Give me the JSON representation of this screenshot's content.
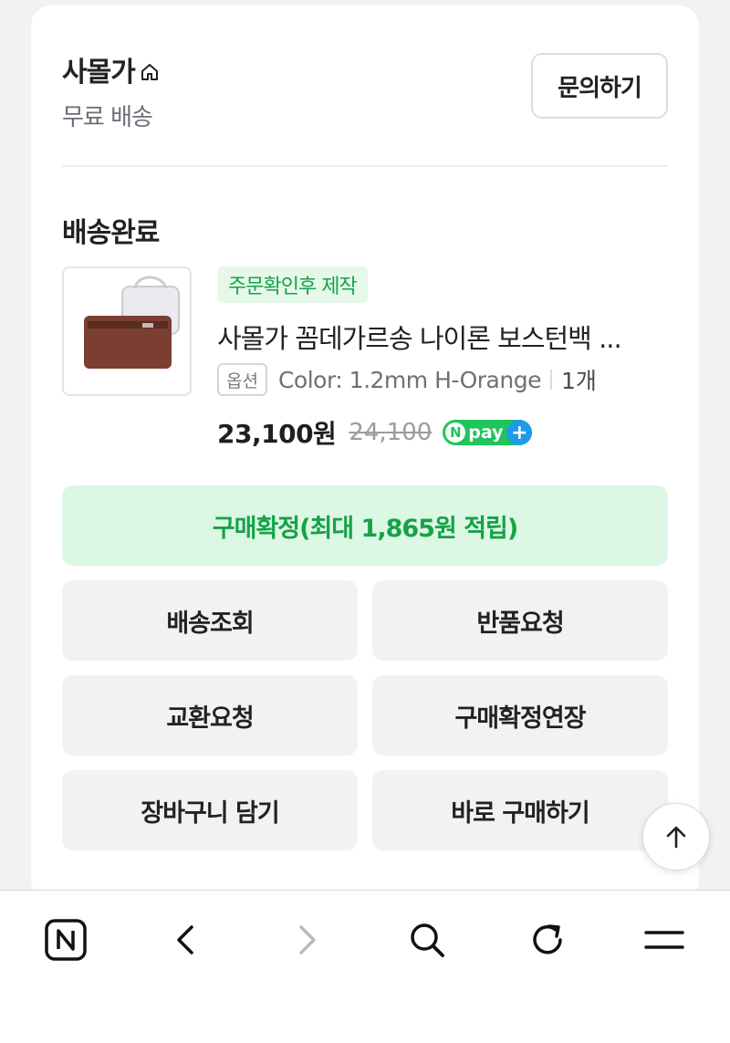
{
  "seller": {
    "name": "사몰가",
    "home_icon": "home-icon",
    "shipping": "무료 배송",
    "inquiry_label": "문의하기"
  },
  "order": {
    "status": "배송완료",
    "tag": "주문확인후 제작",
    "product_name": "사몰가 꼼데가르송 나이론 보스턴백 ...",
    "option_badge": "옵션",
    "option_value": "Color: 1.2mm H-Orange",
    "quantity": "1개",
    "price": "23,100원",
    "original_price": "24,100",
    "npay_badge": "pay"
  },
  "confirm": {
    "label": "구매확정(최대 1,865원 적립)"
  },
  "actions": [
    "배송조회",
    "반품요청",
    "교환요청",
    "구매확정연장",
    "장바구니 담기",
    "바로 구매하기"
  ],
  "bottom_nav": {
    "icons": [
      "naver-n-icon",
      "back-arrow-icon",
      "forward-arrow-icon",
      "search-icon",
      "refresh-icon",
      "menu-icon"
    ]
  },
  "colors": {
    "accent_green": "#15a348",
    "confirm_bg": "#ddf7e5",
    "tag_bg": "#e5f8ea",
    "npay_green": "#1fc45a",
    "npay_blue": "#1d9ae8"
  }
}
